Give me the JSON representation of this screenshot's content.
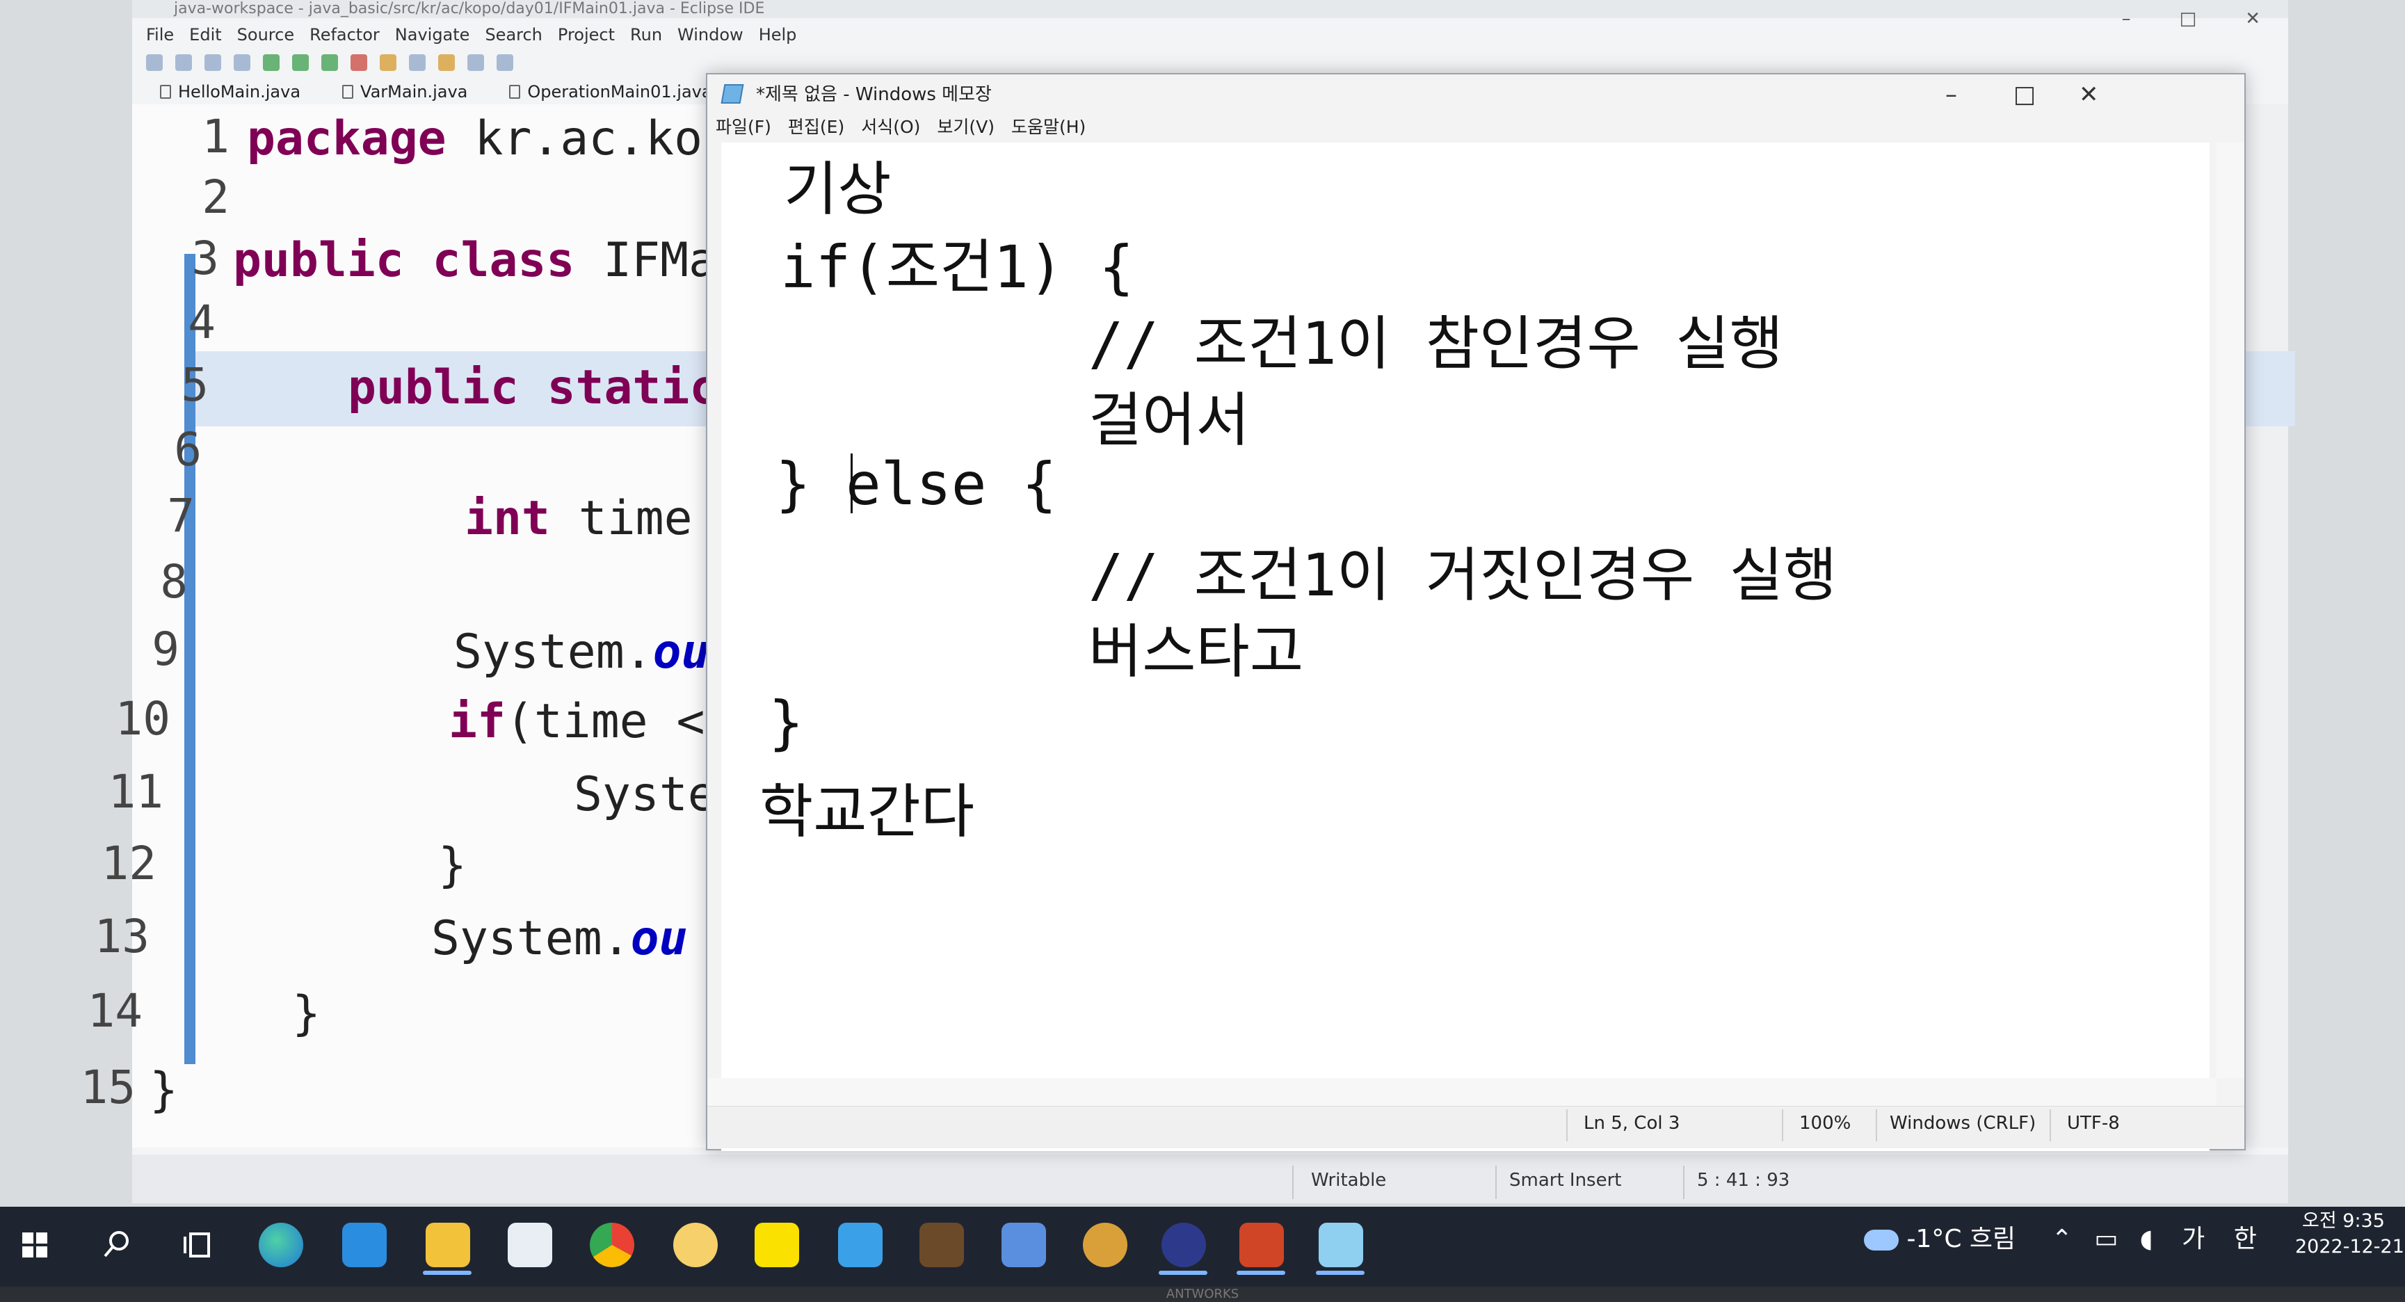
{
  "eclipse": {
    "title": "java-workspace - java_basic/src/kr/ac/kopo/day01/IFMain01.java - Eclipse IDE",
    "window_controls": [
      "–",
      "□",
      "✕"
    ],
    "menu": [
      "File",
      "Edit",
      "Source",
      "Refactor",
      "Navigate",
      "Search",
      "Project",
      "Run",
      "Window",
      "Help"
    ],
    "tabs": [
      "HelloMain.java",
      "VarMain.java",
      "OperationMain01.java"
    ],
    "line_numbers": [
      "1",
      "2",
      "3",
      "4",
      "5",
      "6",
      "7",
      "8",
      "9",
      "10",
      "11",
      "12",
      "13",
      "14",
      "15"
    ],
    "code": {
      "l1_kw": "package",
      "l1_rest": " kr.ac.kop",
      "l3_kw": "public class",
      "l3_rest": " IFMa",
      "l5_kw": "public static",
      "l7_kw": "int",
      "l7_rest": " time",
      "l9_rest": "System.",
      "l9_fld": "ou",
      "l10_kw": "if",
      "l10_rest": "(time <",
      "l11_rest": "Syste",
      "l12_rest": "}",
      "l13_rest": "System.",
      "l13_fld": "ou",
      "l14_rest": "}",
      "l15_rest": "}"
    },
    "status": {
      "writable": "Writable",
      "insert_mode": "Smart Insert",
      "position": "5 : 41 : 93"
    }
  },
  "notepad": {
    "title": "*제목 없음 - Windows 메모장",
    "window_controls": [
      "–",
      "□",
      "✕"
    ],
    "menu": [
      "파일(F)",
      "편집(E)",
      "서식(O)",
      "보기(V)",
      "도움말(H)"
    ],
    "lines": [
      "기상",
      "if(조건1) {",
      "// 조건1이 참인경우 실행",
      "걸어서",
      "} else {",
      "// 조건1이 거짓인경우 실행",
      "버스타고",
      "}",
      "학교간다"
    ],
    "status": {
      "position": "Ln 5, Col 3",
      "zoom": "100%",
      "line_ending": "Windows (CRLF)",
      "encoding": "UTF-8"
    }
  },
  "taskbar": {
    "icons": [
      "windows-start-icon",
      "search-icon",
      "task-view-icon",
      "edge-icon",
      "mail-icon",
      "file-explorer-icon",
      "store-icon",
      "chrome-icon",
      "kakao-icon",
      "kakaotalk-icon",
      "app-icon-1",
      "app-icon-2",
      "app-icon-3",
      "app-icon-4",
      "eclipse-icon",
      "powerpoint-icon",
      "notepad-icon"
    ],
    "weather": "-1°C 흐림",
    "ime": [
      "가",
      "한"
    ],
    "clock_time": "오전 9:35",
    "clock_date": "2022-12-21"
  },
  "bezel_label": "ANTWORKS",
  "colors": {
    "keyword": "#7f0055",
    "field": "#0000c0",
    "taskbar": "#1f2530",
    "highlight_line": "#dbe6f4"
  }
}
